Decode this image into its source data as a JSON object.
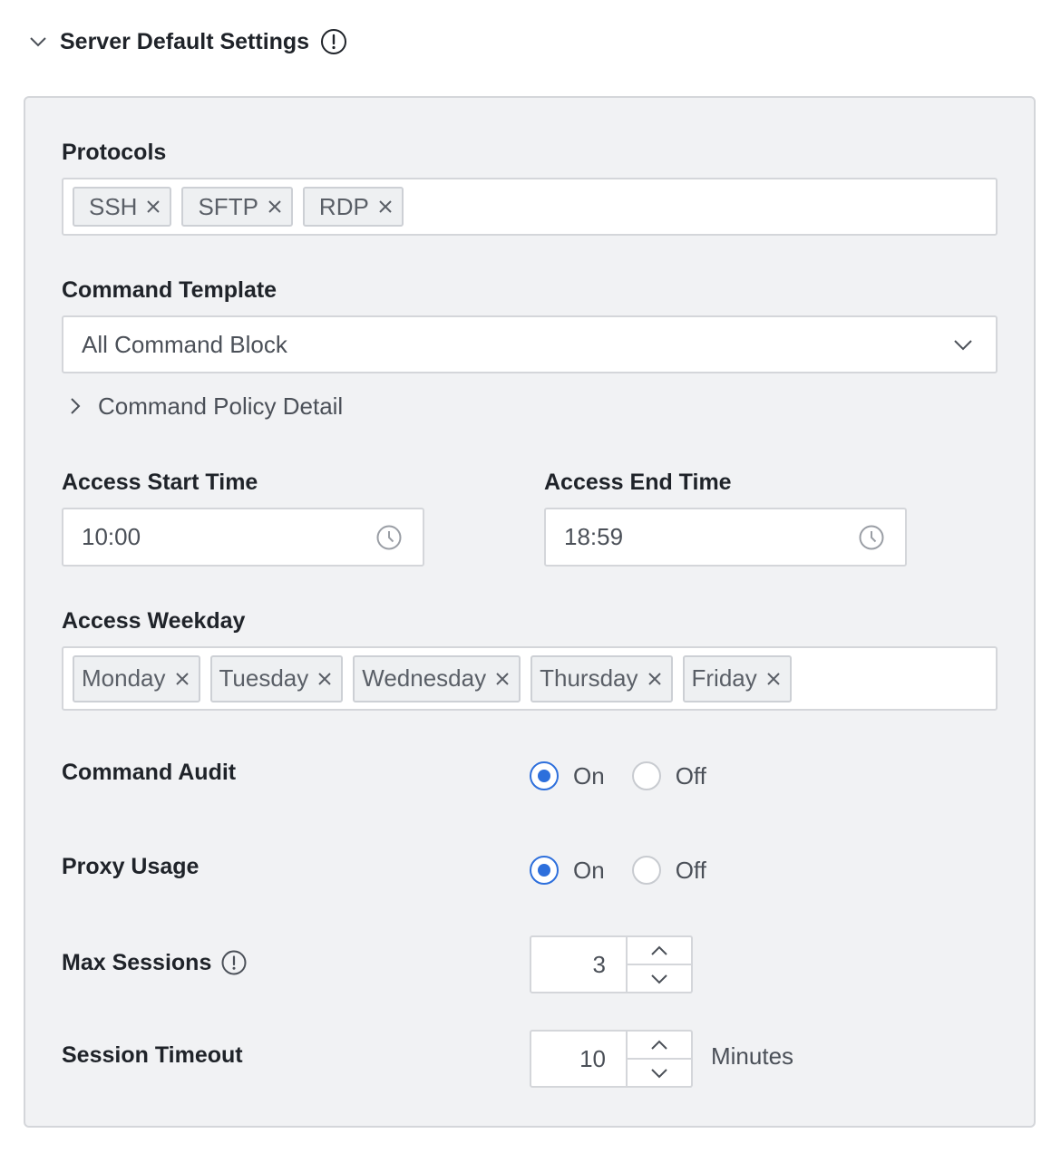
{
  "section": {
    "title": "Server Default Settings",
    "collapse_icon": "chevron-down-icon",
    "info_icon": "info-icon"
  },
  "protocols": {
    "label": "Protocols",
    "tags": [
      "SSH",
      "SFTP",
      "RDP"
    ]
  },
  "command_template": {
    "label": "Command Template",
    "value": "All Command Block",
    "policy_detail_label": "Command Policy Detail"
  },
  "access_time": {
    "start_label": "Access Start Time",
    "start_value": "10:00",
    "end_label": "Access End Time",
    "end_value": "18:59",
    "icon": "clock-icon"
  },
  "weekday": {
    "label": "Access Weekday",
    "tags": [
      "Monday",
      "Tuesday",
      "Wednesday",
      "Thursday",
      "Friday"
    ]
  },
  "command_audit": {
    "label": "Command Audit",
    "options": [
      "On",
      "Off"
    ],
    "selected": "On"
  },
  "proxy_usage": {
    "label": "Proxy Usage",
    "options": [
      "On",
      "Off"
    ],
    "selected": "On"
  },
  "max_sessions": {
    "label": "Max Sessions",
    "value": "3"
  },
  "session_timeout": {
    "label": "Session Timeout",
    "value": "10",
    "unit": "Minutes"
  },
  "colors": {
    "accent": "#2d6fdc",
    "panel_bg": "#f1f2f4",
    "border": "#d4d6da"
  }
}
